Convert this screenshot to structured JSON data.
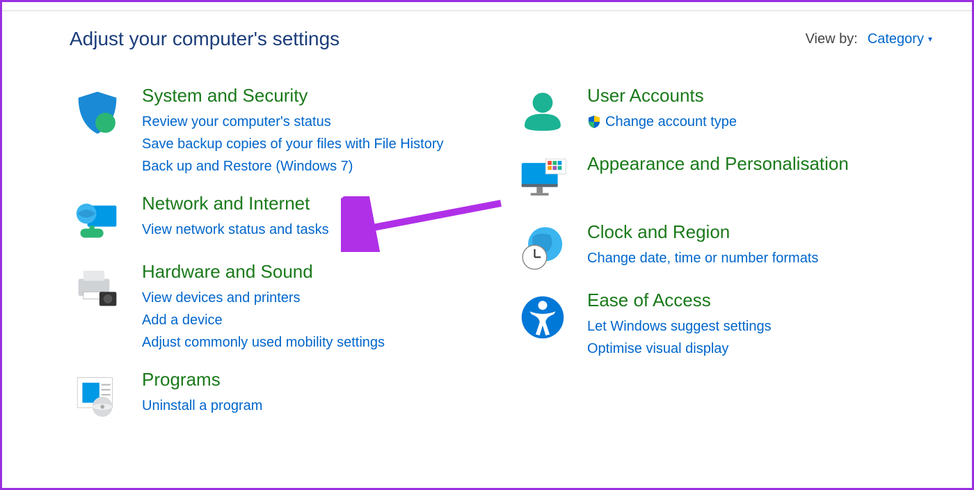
{
  "header": {
    "title": "Adjust your computer's settings",
    "view_by_label": "View by:",
    "view_by_value": "Category"
  },
  "left_column": [
    {
      "id": "system-security",
      "title": "System and Security",
      "links": [
        "Review your computer's status",
        "Save backup copies of your files with File History",
        "Back up and Restore (Windows 7)"
      ]
    },
    {
      "id": "network-internet",
      "title": "Network and Internet",
      "links": [
        "View network status and tasks"
      ]
    },
    {
      "id": "hardware-sound",
      "title": "Hardware and Sound",
      "links": [
        "View devices and printers",
        "Add a device",
        "Adjust commonly used mobility settings"
      ]
    },
    {
      "id": "programs",
      "title": "Programs",
      "links": [
        "Uninstall a program"
      ]
    }
  ],
  "right_column": [
    {
      "id": "user-accounts",
      "title": "User Accounts",
      "links": [
        "Change account type"
      ],
      "shield_on_first": true
    },
    {
      "id": "appearance-personalisation",
      "title": "Appearance and Personalisation",
      "links": []
    },
    {
      "id": "clock-region",
      "title": "Clock and Region",
      "links": [
        "Change date, time or number formats"
      ]
    },
    {
      "id": "ease-of-access",
      "title": "Ease of Access",
      "links": [
        "Let Windows suggest settings",
        "Optimise visual display"
      ]
    }
  ]
}
